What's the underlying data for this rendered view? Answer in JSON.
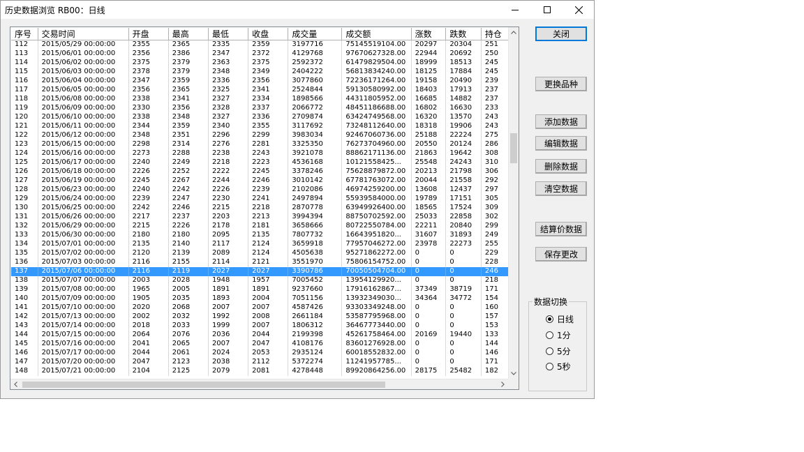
{
  "window": {
    "title": "历史数据浏览 RB00：日线"
  },
  "table": {
    "columns": [
      "序号",
      "交易时间",
      "开盘",
      "最高",
      "最低",
      "收盘",
      "成交量",
      "成交额",
      "涨数",
      "跌数",
      "持仓"
    ],
    "selected_index": 25,
    "rows": [
      [
        "112",
        "2015/05/29 00:00:00",
        "2355",
        "2365",
        "2335",
        "2359",
        "3197716",
        "75145519104.00",
        "20297",
        "20304",
        "251"
      ],
      [
        "113",
        "2015/06/01 00:00:00",
        "2356",
        "2386",
        "2347",
        "2372",
        "4129768",
        "97670627328.00",
        "22944",
        "20692",
        "250"
      ],
      [
        "114",
        "2015/06/02 00:00:00",
        "2375",
        "2379",
        "2363",
        "2375",
        "2592372",
        "61479829504.00",
        "18999",
        "18513",
        "245"
      ],
      [
        "115",
        "2015/06/03 00:00:00",
        "2378",
        "2379",
        "2348",
        "2349",
        "2404222",
        "56813834240.00",
        "18125",
        "17884",
        "245"
      ],
      [
        "116",
        "2015/06/04 00:00:00",
        "2347",
        "2359",
        "2336",
        "2356",
        "3077860",
        "72236171264.00",
        "19158",
        "20490",
        "239"
      ],
      [
        "117",
        "2015/06/05 00:00:00",
        "2356",
        "2365",
        "2325",
        "2341",
        "2524844",
        "59130580992.00",
        "18403",
        "17913",
        "237"
      ],
      [
        "118",
        "2015/06/08 00:00:00",
        "2338",
        "2341",
        "2327",
        "2334",
        "1898566",
        "44311805952.00",
        "16685",
        "14882",
        "237"
      ],
      [
        "119",
        "2015/06/09 00:00:00",
        "2330",
        "2356",
        "2328",
        "2337",
        "2066772",
        "48451186688.00",
        "16802",
        "16630",
        "233"
      ],
      [
        "120",
        "2015/06/10 00:00:00",
        "2338",
        "2348",
        "2327",
        "2336",
        "2709874",
        "63424749568.00",
        "16320",
        "13570",
        "243"
      ],
      [
        "121",
        "2015/06/11 00:00:00",
        "2344",
        "2359",
        "2340",
        "2355",
        "3117692",
        "73248112640.00",
        "18318",
        "19906",
        "243"
      ],
      [
        "122",
        "2015/06/12 00:00:00",
        "2348",
        "2351",
        "2296",
        "2299",
        "3983034",
        "92467060736.00",
        "25188",
        "22224",
        "275"
      ],
      [
        "123",
        "2015/06/15 00:00:00",
        "2298",
        "2314",
        "2276",
        "2281",
        "3325350",
        "76273704960.00",
        "20550",
        "20124",
        "286"
      ],
      [
        "124",
        "2015/06/16 00:00:00",
        "2273",
        "2288",
        "2238",
        "2243",
        "3921078",
        "88862171136.00",
        "21863",
        "19642",
        "308"
      ],
      [
        "125",
        "2015/06/17 00:00:00",
        "2240",
        "2249",
        "2218",
        "2223",
        "4536168",
        "10121558425...",
        "25548",
        "24243",
        "310"
      ],
      [
        "126",
        "2015/06/18 00:00:00",
        "2226",
        "2252",
        "2222",
        "2245",
        "3378246",
        "75628879872.00",
        "20213",
        "21798",
        "306"
      ],
      [
        "127",
        "2015/06/19 00:00:00",
        "2245",
        "2267",
        "2244",
        "2246",
        "3010142",
        "67781763072.00",
        "20044",
        "21558",
        "292"
      ],
      [
        "128",
        "2015/06/23 00:00:00",
        "2240",
        "2242",
        "2226",
        "2239",
        "2102086",
        "46974259200.00",
        "13608",
        "12437",
        "297"
      ],
      [
        "129",
        "2015/06/24 00:00:00",
        "2239",
        "2247",
        "2230",
        "2241",
        "2497894",
        "55939584000.00",
        "19789",
        "17151",
        "305"
      ],
      [
        "130",
        "2015/06/25 00:00:00",
        "2242",
        "2246",
        "2215",
        "2218",
        "2870778",
        "63949926400.00",
        "18565",
        "17524",
        "309"
      ],
      [
        "131",
        "2015/06/26 00:00:00",
        "2217",
        "2237",
        "2203",
        "2213",
        "3994394",
        "88750702592.00",
        "25033",
        "22858",
        "302"
      ],
      [
        "132",
        "2015/06/29 00:00:00",
        "2215",
        "2226",
        "2178",
        "2181",
        "3658666",
        "80722550784.00",
        "22211",
        "20840",
        "299"
      ],
      [
        "133",
        "2015/06/30 00:00:00",
        "2180",
        "2180",
        "2095",
        "2135",
        "7807732",
        "16643951820...",
        "31607",
        "31893",
        "249"
      ],
      [
        "134",
        "2015/07/01 00:00:00",
        "2135",
        "2140",
        "2117",
        "2124",
        "3659918",
        "77957046272.00",
        "23978",
        "22273",
        "255"
      ],
      [
        "135",
        "2015/07/02 00:00:00",
        "2120",
        "2139",
        "2089",
        "2124",
        "4505638",
        "95271862272.00",
        "0",
        "0",
        "229"
      ],
      [
        "136",
        "2015/07/03 00:00:00",
        "2116",
        "2155",
        "2114",
        "2121",
        "3551970",
        "75806154752.00",
        "0",
        "0",
        "228"
      ],
      [
        "137",
        "2015/07/06 00:00:00",
        "2116",
        "2119",
        "2027",
        "2027",
        "3390786",
        "70050504704.00",
        "0",
        "0",
        "246"
      ],
      [
        "138",
        "2015/07/07 00:00:00",
        "2003",
        "2028",
        "1948",
        "1957",
        "7005452",
        "13954129920...",
        "0",
        "0",
        "218"
      ],
      [
        "139",
        "2015/07/08 00:00:00",
        "1965",
        "2005",
        "1891",
        "1891",
        "9237660",
        "17916162867...",
        "37349",
        "38719",
        "171"
      ],
      [
        "140",
        "2015/07/09 00:00:00",
        "1905",
        "2035",
        "1893",
        "2004",
        "7051156",
        "13932349030...",
        "34364",
        "34772",
        "154"
      ],
      [
        "141",
        "2015/07/10 00:00:00",
        "2020",
        "2068",
        "2007",
        "2007",
        "4587426",
        "93303349248.00",
        "0",
        "0",
        "160"
      ],
      [
        "142",
        "2015/07/13 00:00:00",
        "2002",
        "2032",
        "1992",
        "2008",
        "2661184",
        "53587795968.00",
        "0",
        "0",
        "157"
      ],
      [
        "143",
        "2015/07/14 00:00:00",
        "2018",
        "2033",
        "1999",
        "2007",
        "1806312",
        "36467773440.00",
        "0",
        "0",
        "153"
      ],
      [
        "144",
        "2015/07/15 00:00:00",
        "2064",
        "2076",
        "2036",
        "2044",
        "2199398",
        "45261758464.00",
        "20169",
        "19440",
        "133"
      ],
      [
        "145",
        "2015/07/16 00:00:00",
        "2041",
        "2065",
        "2007",
        "2047",
        "4108176",
        "83601276928.00",
        "0",
        "0",
        "144"
      ],
      [
        "146",
        "2015/07/17 00:00:00",
        "2044",
        "2061",
        "2024",
        "2053",
        "2935124",
        "60018552832.00",
        "0",
        "0",
        "146"
      ],
      [
        "147",
        "2015/07/20 00:00:00",
        "2047",
        "2123",
        "2038",
        "2112",
        "5372274",
        "11241957785...",
        "0",
        "0",
        "171"
      ],
      [
        "148",
        "2015/07/21 00:00:00",
        "2104",
        "2125",
        "2079",
        "2081",
        "4278448",
        "89920864256.00",
        "28175",
        "25482",
        "182"
      ]
    ]
  },
  "buttons": {
    "close": "关闭",
    "change_symbol": "更换品种",
    "add_data": "添加数据",
    "edit_data": "编辑数据",
    "delete_data": "删除数据",
    "clear_data": "清空数据",
    "settlement_data": "结算价数据",
    "save_changes": "保存更改"
  },
  "data_switch": {
    "title": "数据切换",
    "options": [
      "日线",
      "1分",
      "5分",
      "5秒"
    ],
    "selected": "日线"
  },
  "colors": {
    "selection": "#3399ff",
    "default_button_border": "#0078d7"
  },
  "icons": {
    "minimize": "minimize-icon",
    "maximize": "maximize-icon",
    "close": "close-icon",
    "scroll_up": "chevron-up-icon",
    "scroll_down": "chevron-down-icon",
    "scroll_left": "chevron-left-icon",
    "scroll_right": "chevron-right-icon"
  }
}
